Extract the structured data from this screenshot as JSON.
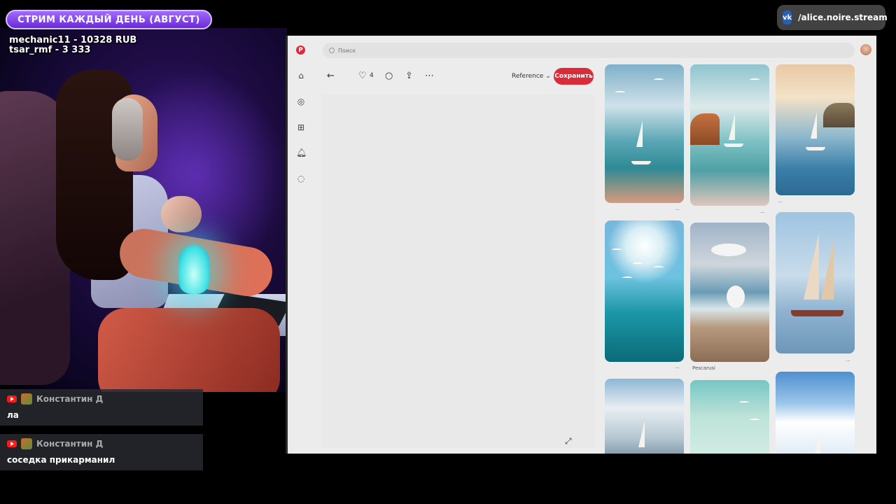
{
  "overlay": {
    "stream_badge": "СТРИМ КАЖДЫЙ ДЕНЬ (АВГУСТ)",
    "donations": [
      "mechanic11 - 10328 RUB",
      "tsar_rmf - 3 333"
    ],
    "vk_logo": "vk-icon",
    "vk_handle": "/alice.noire.stream"
  },
  "chat": [
    {
      "user": "Константин Д",
      "text": "ла",
      "platform": "youtube-icon"
    },
    {
      "user": "Константин Д",
      "text": "соседка прикарманил",
      "platform": "youtube-icon"
    }
  ],
  "pinterest": {
    "logo": "P",
    "search_placeholder": "Поиск",
    "nav_icons": [
      "home-icon",
      "explore-icon",
      "create-icon",
      "notifications-icon",
      "messages-icon"
    ],
    "toolbar": {
      "back_icon": "arrow-left-icon",
      "like_icon": "heart-icon",
      "like_count": "4",
      "comment_icon": "comment-icon",
      "share_icon": "share-icon",
      "more_icon": "more-icon",
      "board_label": "Reference",
      "save_label": "Сохранить"
    },
    "grid": [
      {
        "meta": "..."
      },
      {
        "meta": "..."
      },
      {
        "meta": "..."
      },
      {
        "meta": "..."
      },
      {
        "meta": "Pescarusi"
      },
      {
        "meta": "..."
      }
    ]
  },
  "colors": {
    "stream_badge": "#7c3ff0",
    "pinterest_red": "#d92b3a",
    "vk_blue": "#2a5fb3"
  }
}
